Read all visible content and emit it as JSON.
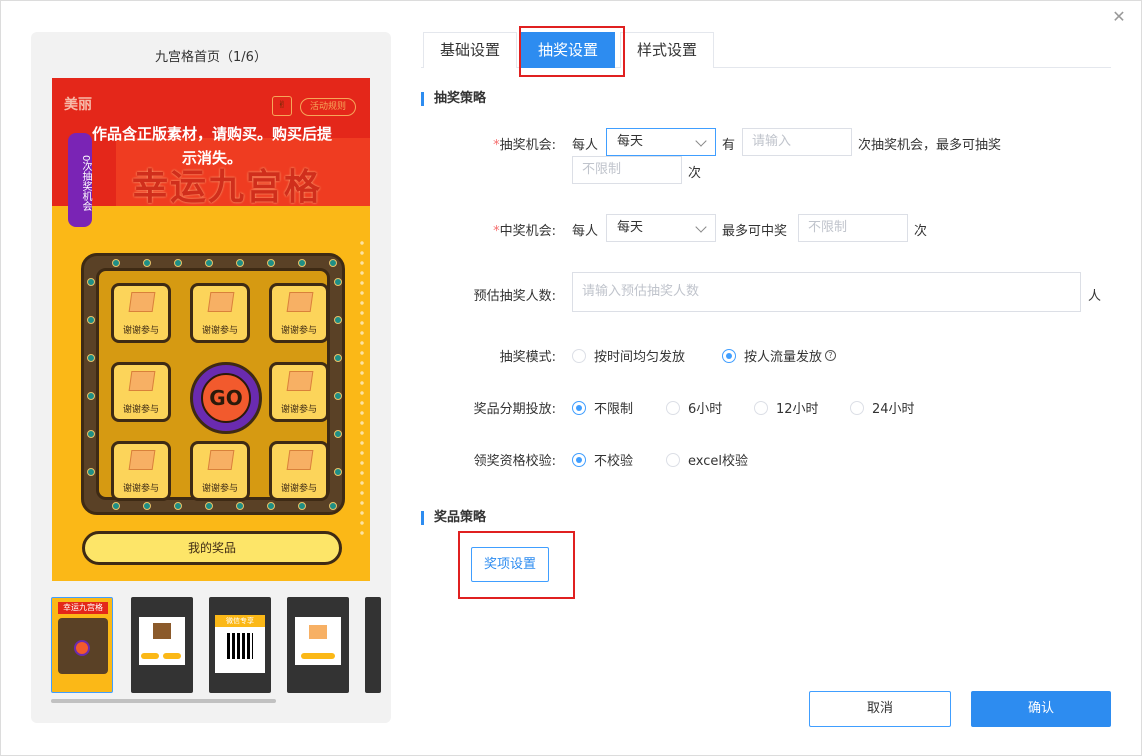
{
  "left_panel": {
    "title": "九宫格首页（1/6）",
    "preview": {
      "logo": "美丽",
      "share_icon": "share-icon",
      "rules_label": "活动规则",
      "game_title": "幸运九宫格",
      "side_badge": "0次抽奖机会",
      "watermark": "作品含正版素材，请购买。购买后提示消失。",
      "cell_label": "谢谢参与",
      "go_label": "GO",
      "my_prize": "我的奖品"
    },
    "thumbnails": [
      {
        "label": "幸运九宫格"
      },
      {
        "label": ""
      },
      {
        "label": "微信专享"
      },
      {
        "label": ""
      }
    ]
  },
  "tabs": [
    {
      "label": "基础设置",
      "active": false
    },
    {
      "label": "抽奖设置",
      "active": true
    },
    {
      "label": "样式设置",
      "active": false
    }
  ],
  "lottery_strategy": {
    "section_title": "抽奖策略",
    "chance": {
      "label": "抽奖机会:",
      "per": "每人",
      "period": "每天",
      "has": "有",
      "count_placeholder": "请输入",
      "suffix": "次抽奖机会，最多可抽奖",
      "max_placeholder": "不限制",
      "unit": "次"
    },
    "win": {
      "label": "中奖机会:",
      "per": "每人",
      "period": "每天",
      "max_label": "最多可中奖",
      "max_placeholder": "不限制",
      "unit": "次"
    },
    "estimate": {
      "label": "预估抽奖人数:",
      "placeholder": "请输入预估抽奖人数",
      "unit": "人"
    },
    "mode": {
      "label": "抽奖模式:",
      "options": [
        "按时间均匀发放",
        "按人流量发放"
      ],
      "selected": 1
    },
    "staging": {
      "label": "奖品分期投放:",
      "options": [
        "不限制",
        "6小时",
        "12小时",
        "24小时"
      ],
      "selected": 0
    },
    "verify": {
      "label": "领奖资格校验:",
      "options": [
        "不校验",
        "excel校验"
      ],
      "selected": 0
    }
  },
  "prize_strategy": {
    "section_title": "奖品策略",
    "button": "奖项设置"
  },
  "footer": {
    "cancel": "取消",
    "confirm": "确认"
  },
  "colors": {
    "primary": "#2d8cf0",
    "highlight": "#e02020",
    "required": "#f56c6c"
  }
}
